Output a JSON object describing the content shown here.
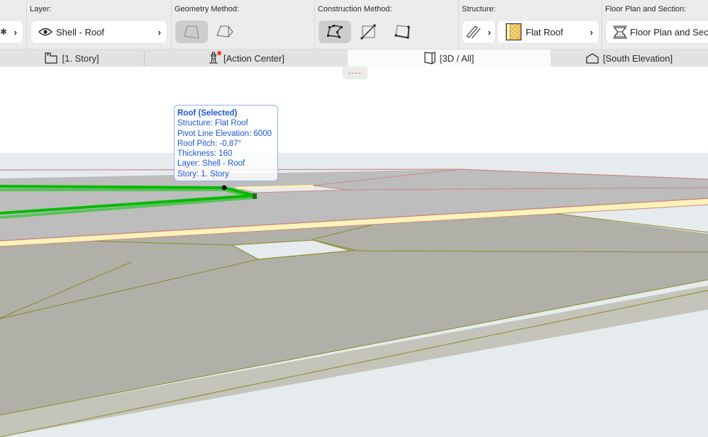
{
  "toolbar": {
    "groups": [
      {
        "label": "Layer:",
        "value": "Shell - Roof",
        "icon": "eye-icon"
      },
      {
        "label": "Geometry Method:",
        "buttons": [
          {
            "icon": "simple-polygon-icon",
            "selected": true
          },
          {
            "icon": "polyroof-icon",
            "selected": false
          }
        ]
      },
      {
        "label": "Construction Method:",
        "buttons": [
          {
            "icon": "polygonal-construction-icon",
            "selected": true
          },
          {
            "icon": "rectangle-construction-icon",
            "selected": false
          },
          {
            "icon": "rotated-rectangle-construction-icon",
            "selected": false
          }
        ]
      },
      {
        "label": "Structure:",
        "type_icon": "composite-structure-icon",
        "value": "Flat Roof",
        "swatch_icon": "insulation-swatch-icon"
      },
      {
        "label": "Floor Plan and Section:",
        "value": "Floor Plan and Sect",
        "icon": "floor-plan-section-icon"
      }
    ]
  },
  "tabs": [
    {
      "label": "[1. Story]",
      "icon": "story-plan-icon",
      "active": false
    },
    {
      "label": "[Action Center]",
      "icon": "lighthouse-icon",
      "active": false,
      "badge": true
    },
    {
      "label": "[3D / All]",
      "icon": "3d-box-icon",
      "active": true
    },
    {
      "label": "[South Elevation]",
      "icon": "elevation-house-icon",
      "active": false
    }
  ],
  "viewport": {
    "handle_text": "----",
    "tooltip": {
      "title": "Roof (Selected)",
      "lines": [
        "Structure: Flat Roof",
        "Pivot Line Elevation: 6000",
        "Roof Pitch: -0,87°",
        "Thickness: 160",
        "Layer: Shell - Roof",
        "Story: 1. Story"
      ]
    }
  },
  "colors": {
    "selection_green": "#00bb00",
    "roof_top_gray": "#bdbdbd",
    "lower_roof_gray": "#b0b0a8",
    "edge_red": "#c88a8a",
    "edge_olive": "#8a8a1e",
    "cut_fill_yellow": "#fff3b8",
    "tooltip_blue": "#1d55d6"
  }
}
